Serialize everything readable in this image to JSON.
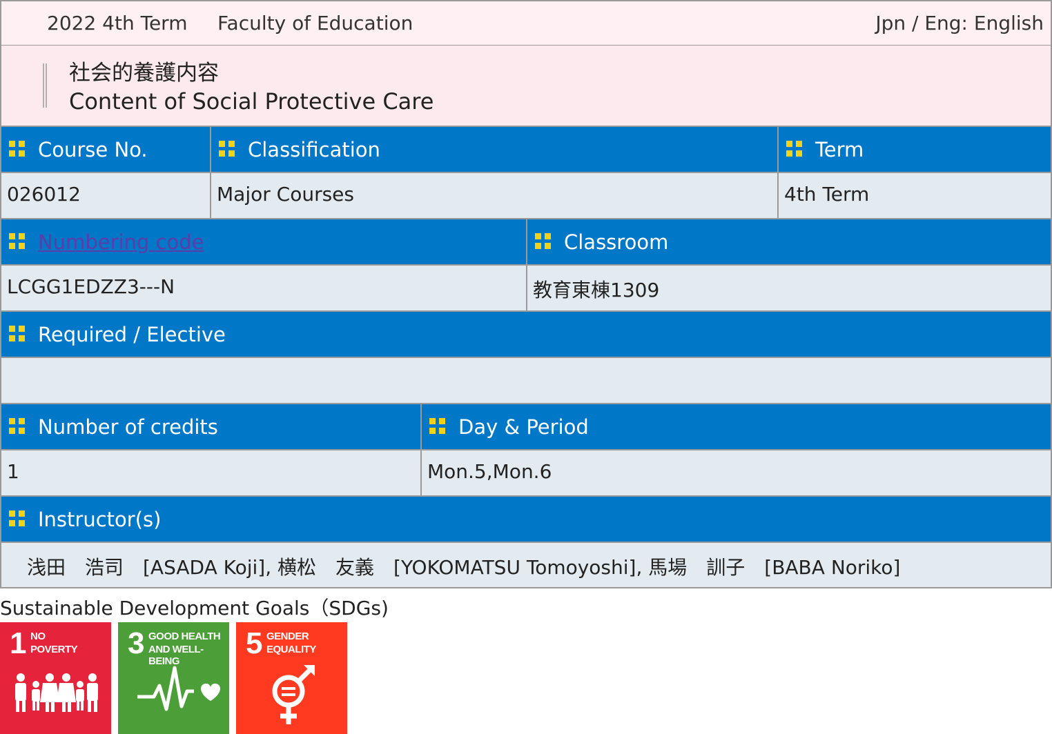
{
  "header": {
    "term": "2022 4th Term",
    "faculty": "Faculty of Education",
    "language": "Jpn / Eng: English"
  },
  "course": {
    "title_jp": "社会的養護内容",
    "title_en": "Content of Social Protective Care"
  },
  "fields": {
    "course_no": {
      "label": "Course No.",
      "value": "026012"
    },
    "classification": {
      "label": "Classification",
      "value": "Major Courses"
    },
    "term": {
      "label": "Term",
      "value": "4th Term"
    },
    "numbering_code": {
      "label": "Numbering code",
      "value": "LCGG1EDZZ3---N"
    },
    "classroom": {
      "label": "Classroom",
      "value": "教育東棟1309"
    },
    "required_elective": {
      "label": "Required / Elective",
      "value": ""
    },
    "credits": {
      "label": "Number of credits",
      "value": "1"
    },
    "day_period": {
      "label": "Day & Period",
      "value": "Mon.5,Mon.6"
    },
    "instructors": {
      "label": "Instructor(s)",
      "value": "浅田　浩司　[ASADA Koji], 横松　友義　[YOKOMATSU Tomoyoshi], 馬場　訓子　[BABA Noriko]"
    }
  },
  "sdgs": {
    "title": "Sustainable Development Goals（SDGs)",
    "goals": [
      {
        "number": "1",
        "line1": "NO",
        "line2": "POVERTY",
        "color": "#e5243b",
        "icon": "family-icon"
      },
      {
        "number": "3",
        "line1": "GOOD HEALTH",
        "line2": "AND WELL-BEING",
        "color": "#4c9f38",
        "icon": "heartbeat-icon"
      },
      {
        "number": "5",
        "line1": "GENDER",
        "line2": "EQUALITY",
        "color": "#ff3a21",
        "icon": "gender-equality-icon"
      }
    ]
  },
  "colors": {
    "header_blue": "#0077c7",
    "value_bg": "#e3ebf0",
    "title_bg": "#fdeaee",
    "bullet_yellow": "#f2d21b"
  }
}
